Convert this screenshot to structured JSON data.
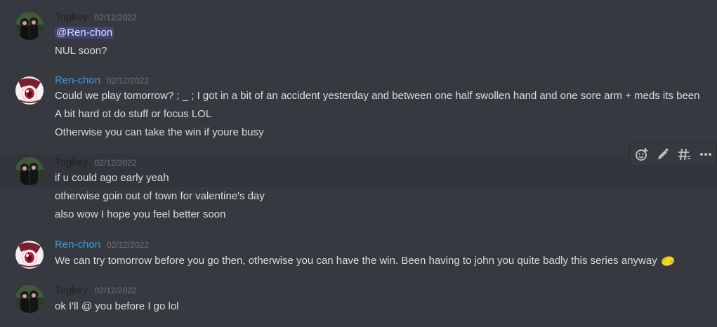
{
  "messages": [
    {
      "author": "Togkey",
      "timestamp": "02/12/2022",
      "lines": [
        {
          "mention": "@Ren-chon"
        },
        {
          "text": "NUL soon?"
        }
      ]
    },
    {
      "author": "Ren-chon",
      "timestamp": "02/12/2022",
      "lines": [
        {
          "text": "Could we play tomorrow? ; _ ; I got in a bit of an accident yesterday and between one half swollen hand and one sore arm + meds its been"
        },
        {
          "text": "A bit hard ot do stuff or focus LOL"
        },
        {
          "text": "Otherwise you can take the win if youre busy"
        }
      ]
    },
    {
      "author": "Togkey",
      "timestamp": "02/12/2022",
      "lines": [
        {
          "text": "if u could ago early yeah"
        },
        {
          "text": "otherwise goin out of town for valentine's day"
        },
        {
          "text": "also wow I hope you feel better soon"
        }
      ]
    },
    {
      "author": "Ren-chon",
      "timestamp": "02/12/2022",
      "lines": [
        {
          "text": "We can try tomorrow before you go then, otherwise you can have the win. Been having to john you quite badly this series anyway",
          "emoji": "lemon-emoji"
        }
      ]
    },
    {
      "author": "Togkey",
      "timestamp": "02/12/2022",
      "lines": [
        {
          "text": "ok I'll @ you before I go lol"
        }
      ]
    }
  ],
  "toolbar": {
    "icons": [
      "add-reaction-icon",
      "edit-pencil-icon",
      "create-thread-icon",
      "more-options-icon"
    ]
  },
  "colors": {
    "background": "#36393f",
    "hover_background": "#32353b",
    "text": "#dcddde",
    "timestamp": "#72767d",
    "ren_name": "#3e9bd6",
    "togkey_name": "#202225",
    "mention_bg": "#4a4f7d"
  }
}
